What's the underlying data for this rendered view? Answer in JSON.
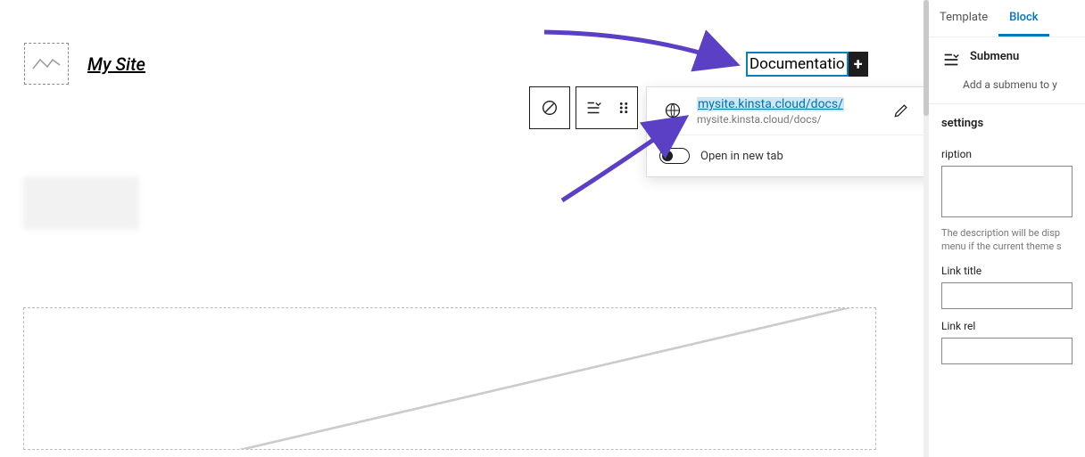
{
  "header": {
    "site_title": "My Site",
    "nav_item_label": "Documentatio"
  },
  "link_popover": {
    "url_text": "mysite.kinsta.cloud/docs/",
    "breadcrumb": "mysite.kinsta.cloud/docs/",
    "open_new_tab_label": "Open in new tab"
  },
  "sidebar": {
    "tabs": {
      "template": "Template",
      "block": "Block"
    },
    "block": {
      "name": "Submenu",
      "description": "Add a submenu to y"
    },
    "panel": {
      "settings_label": "settings",
      "description_label": "ription",
      "description_help": "The description will be disp menu if the current theme s",
      "link_title_label": "Link title",
      "link_rel_label": "Link rel"
    }
  }
}
